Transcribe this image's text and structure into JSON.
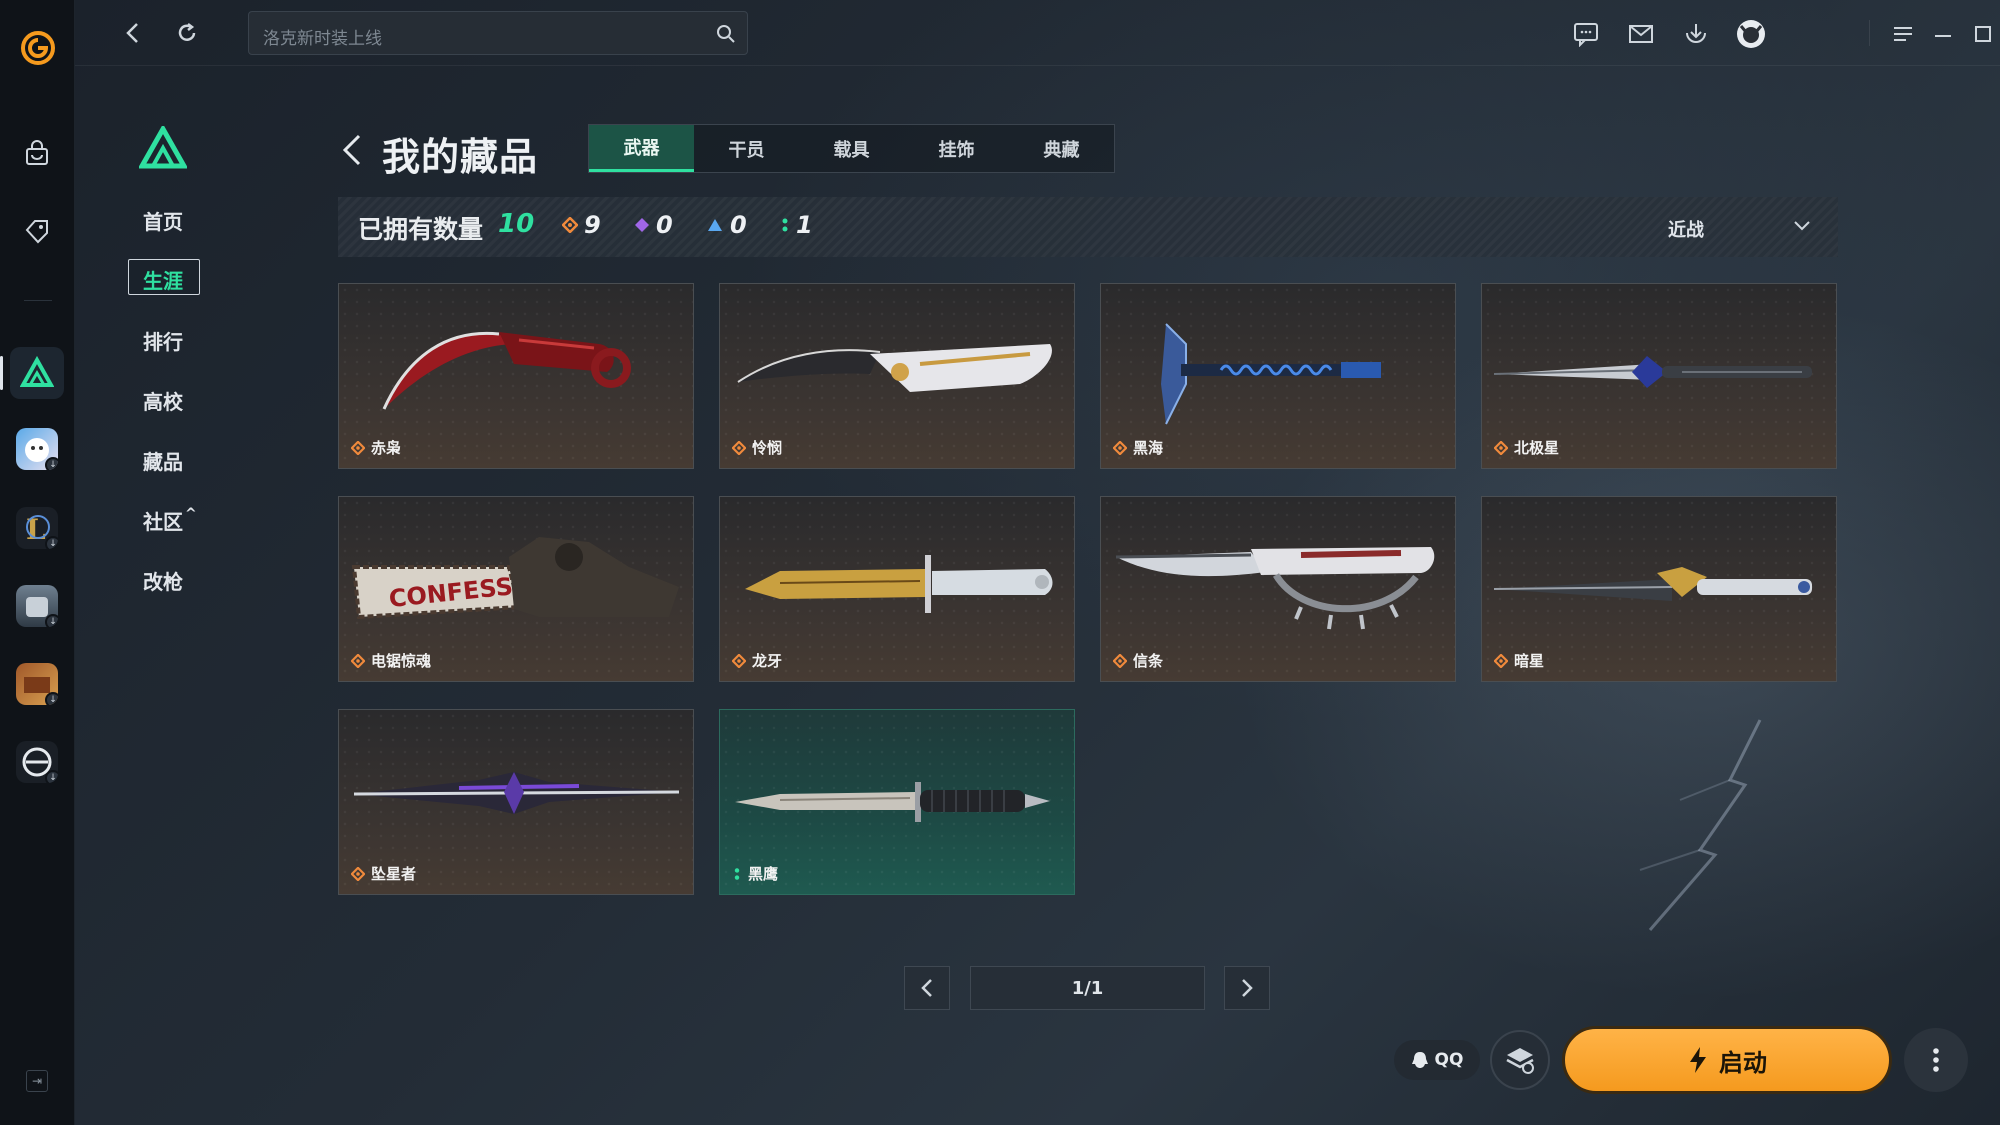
{
  "search": {
    "placeholder": "洛克新时装上线"
  },
  "side_menu": {
    "items": [
      {
        "label": "首页"
      },
      {
        "label": "生涯",
        "active": true
      },
      {
        "label": "排行"
      },
      {
        "label": "高校"
      },
      {
        "label": "藏品"
      },
      {
        "label": "社区"
      },
      {
        "label": "改枪"
      }
    ],
    "community_chevron": "^"
  },
  "header": {
    "title": "我的藏品",
    "tabs": [
      {
        "label": "武器",
        "active": true
      },
      {
        "label": "干员"
      },
      {
        "label": "载具"
      },
      {
        "label": "挂饰"
      },
      {
        "label": "典藏"
      }
    ]
  },
  "stats": {
    "owned_label": "已拥有数量",
    "owned_value": "10",
    "rarities": [
      {
        "icon": "orange-diamond-icon",
        "color": "#f08a3c",
        "count": "9"
      },
      {
        "icon": "purple-diamond-icon",
        "color": "#a066e8",
        "count": "0"
      },
      {
        "icon": "blue-triangle-icon",
        "color": "#5aa8f0",
        "count": "0"
      },
      {
        "icon": "green-dots-icon",
        "color": "#2fe0a0",
        "count": "1"
      }
    ],
    "filter": "近战"
  },
  "items": [
    {
      "name": "赤枭",
      "rarity": "orange"
    },
    {
      "name": "怜悯",
      "rarity": "orange"
    },
    {
      "name": "黑海",
      "rarity": "orange"
    },
    {
      "name": "北极星",
      "rarity": "orange"
    },
    {
      "name": "电锯惊魂",
      "rarity": "orange"
    },
    {
      "name": "龙牙",
      "rarity": "orange"
    },
    {
      "name": "信条",
      "rarity": "orange"
    },
    {
      "name": "暗星",
      "rarity": "orange"
    },
    {
      "name": "坠星者",
      "rarity": "orange"
    },
    {
      "name": "黑鹰",
      "rarity": "green"
    }
  ],
  "pagination": {
    "label": "1/1"
  },
  "bottom": {
    "qq_label": "QQ",
    "launch_label": "启动"
  },
  "colors": {
    "accent": "#2fe0a0",
    "launch": "#f59a1e",
    "orange_rarity": "#f08a3c"
  }
}
